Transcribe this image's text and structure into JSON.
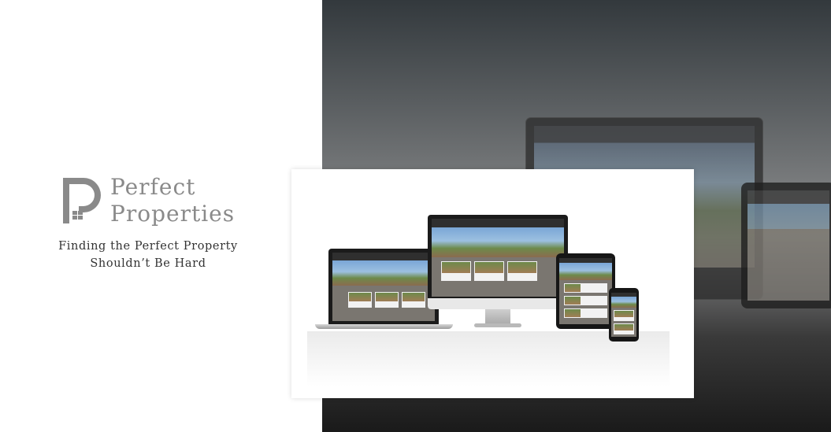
{
  "brand": {
    "line1": "Perfect",
    "line2": "Properties",
    "accent_color": "#8a8a8a"
  },
  "tagline": {
    "line1": "Finding the Perfect Property",
    "line2": "Shouldn’t Be Hard"
  },
  "icons": {
    "logo": "house-p-logo-icon"
  },
  "colors": {
    "panel_bg": "#ffffff",
    "dark_bg": "#33393d"
  }
}
